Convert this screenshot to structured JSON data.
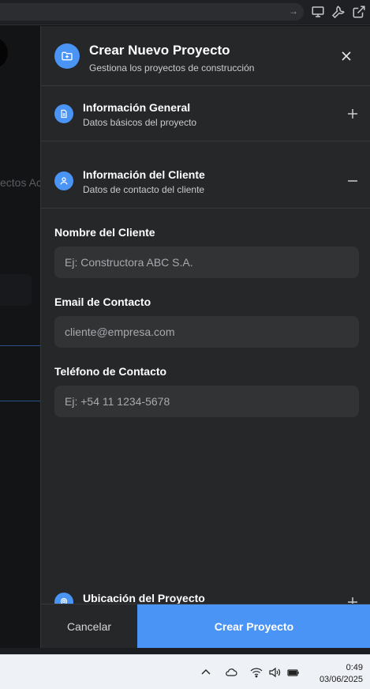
{
  "modal": {
    "title": "Crear Nuevo Proyecto",
    "subtitle": "Gestiona los proyectos de construcción",
    "sections": [
      {
        "title": "Información General",
        "subtitle": "Datos básicos del proyecto",
        "state": "collapsed"
      },
      {
        "title": "Información del Cliente",
        "subtitle": "Datos de contacto del cliente",
        "state": "expanded"
      },
      {
        "title": "Ubicación del Proyecto",
        "subtitle": "",
        "state": "collapsed"
      }
    ],
    "fields": {
      "client_name": {
        "label": "Nombre del Cliente",
        "value": "",
        "placeholder": "Ej: Constructora ABC S.A."
      },
      "contact_email": {
        "label": "Email de Contacto",
        "value": "",
        "placeholder": "cliente@empresa.com"
      },
      "contact_phone": {
        "label": "Teléfono de Contacto",
        "value": "",
        "placeholder": "Ej: +54 11 1234-5678"
      }
    },
    "buttons": {
      "cancel": "Cancelar",
      "create": "Crear Proyecto"
    }
  },
  "background": {
    "partial_text": "ectos Ac"
  },
  "taskbar": {
    "time": "0:49",
    "date": "03/06/2025"
  },
  "colors": {
    "accent": "#4a94f5",
    "modal_bg": "#262729",
    "input_bg": "#323335"
  },
  "icons": [
    "folder-plus-icon",
    "close-icon",
    "document-icon",
    "user-icon",
    "location-icon",
    "plus-icon",
    "minus-icon",
    "arrow-right-icon",
    "monitor-icon",
    "wrench-icon",
    "external-link-icon",
    "chevron-up-icon",
    "cloud-icon",
    "wifi-icon",
    "speaker-icon",
    "battery-icon"
  ]
}
